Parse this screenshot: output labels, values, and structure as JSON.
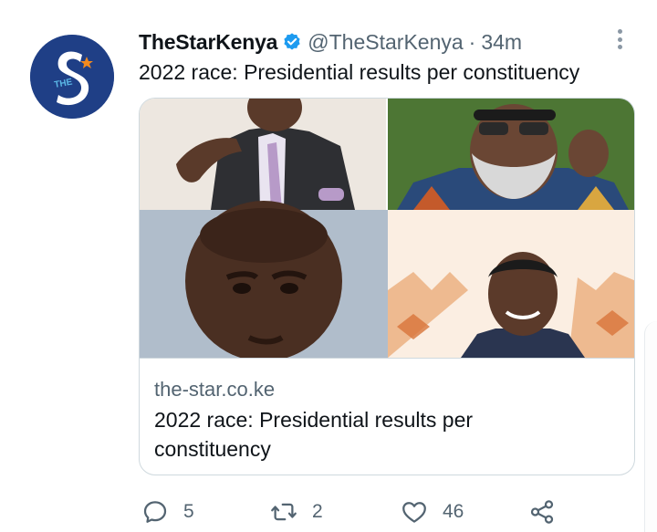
{
  "tweet": {
    "display_name": "TheStarKenya",
    "handle": "@TheStarKenya",
    "separator": "·",
    "time": "34m",
    "text": "2022 race: Presidential results per constituency",
    "avatar_icon": "the-star-logo",
    "verified_icon": "verified-badge-icon"
  },
  "card": {
    "domain": "the-star.co.ke",
    "title": "2022 race: Presidential results per constituency"
  },
  "actions": {
    "reply_count": "5",
    "retweet_count": "2",
    "like_count": "46"
  },
  "colors": {
    "brand_blue": "#1f3f86",
    "verified_blue": "#1d9bf0",
    "text_primary": "#0f1419",
    "text_secondary": "#536471",
    "border": "#cfd9de"
  }
}
